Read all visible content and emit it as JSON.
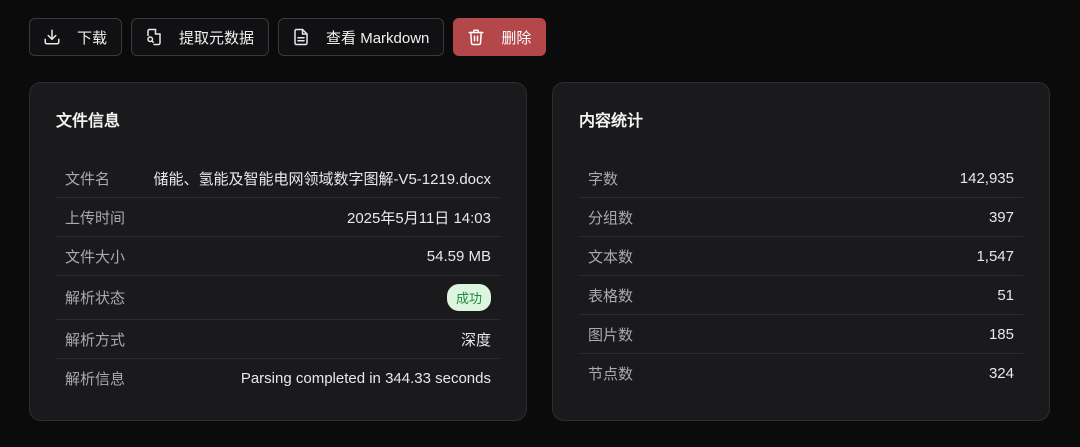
{
  "toolbar": {
    "download_label": "下载",
    "extract_label": "提取元数据",
    "markdown_label": "查看 Markdown",
    "delete_label": "删除"
  },
  "file_info": {
    "title": "文件信息",
    "rows": [
      {
        "label": "文件名",
        "value": "储能、氢能及智能电网领域数字图解-V5-1219.docx"
      },
      {
        "label": "上传时间",
        "value": "2025年5月11日 14:03"
      },
      {
        "label": "文件大小",
        "value": "54.59 MB"
      },
      {
        "label": "解析状态",
        "value": "成功"
      },
      {
        "label": "解析方式",
        "value": "深度"
      },
      {
        "label": "解析信息",
        "value": "Parsing completed in 344.33 seconds"
      }
    ]
  },
  "content_stats": {
    "title": "内容统计",
    "rows": [
      {
        "label": "字数",
        "value": "142,935"
      },
      {
        "label": "分组数",
        "value": "397"
      },
      {
        "label": "文本数",
        "value": "1,547"
      },
      {
        "label": "表格数",
        "value": "51"
      },
      {
        "label": "图片数",
        "value": "185"
      },
      {
        "label": "节点数",
        "value": "324"
      }
    ]
  },
  "colors": {
    "background": "#0b0b0c",
    "card": "#1a1a1c",
    "danger": "#b4474a",
    "success_bg": "#dcf5df",
    "success_text": "#1f8a3b"
  },
  "icons": {
    "download": "download-icon",
    "extract": "file-search-icon",
    "markdown": "document-icon",
    "delete": "trash-icon"
  }
}
